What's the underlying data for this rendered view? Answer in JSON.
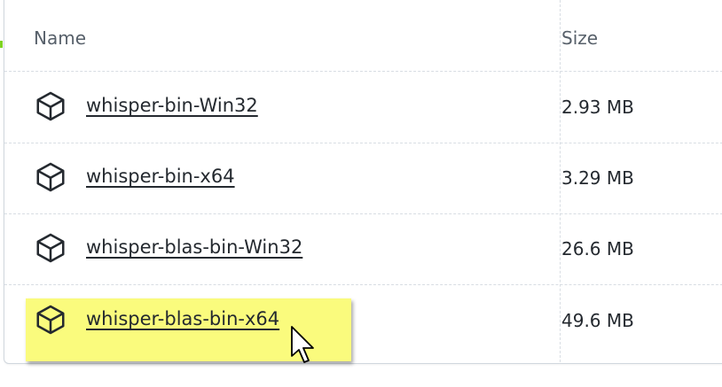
{
  "table": {
    "headers": {
      "name": "Name",
      "size": "Size"
    },
    "rows": [
      {
        "name": "whisper-bin-Win32",
        "size": "2.93 MB",
        "icon": "package-icon"
      },
      {
        "name": "whisper-bin-x64",
        "size": "3.29 MB",
        "icon": "package-icon"
      },
      {
        "name": "whisper-blas-bin-Win32",
        "size": "26.6 MB",
        "icon": "package-icon"
      },
      {
        "name": "whisper-blas-bin-x64",
        "size": "49.6 MB",
        "icon": "package-icon",
        "highlighted": true
      }
    ]
  },
  "colors": {
    "highlight": "#fafb7d",
    "text": "#24292f",
    "header_text": "#57606a",
    "border": "#d0d7de",
    "accent": "#7ed321"
  },
  "cursor": {
    "icon": "mouse-pointer-icon"
  }
}
